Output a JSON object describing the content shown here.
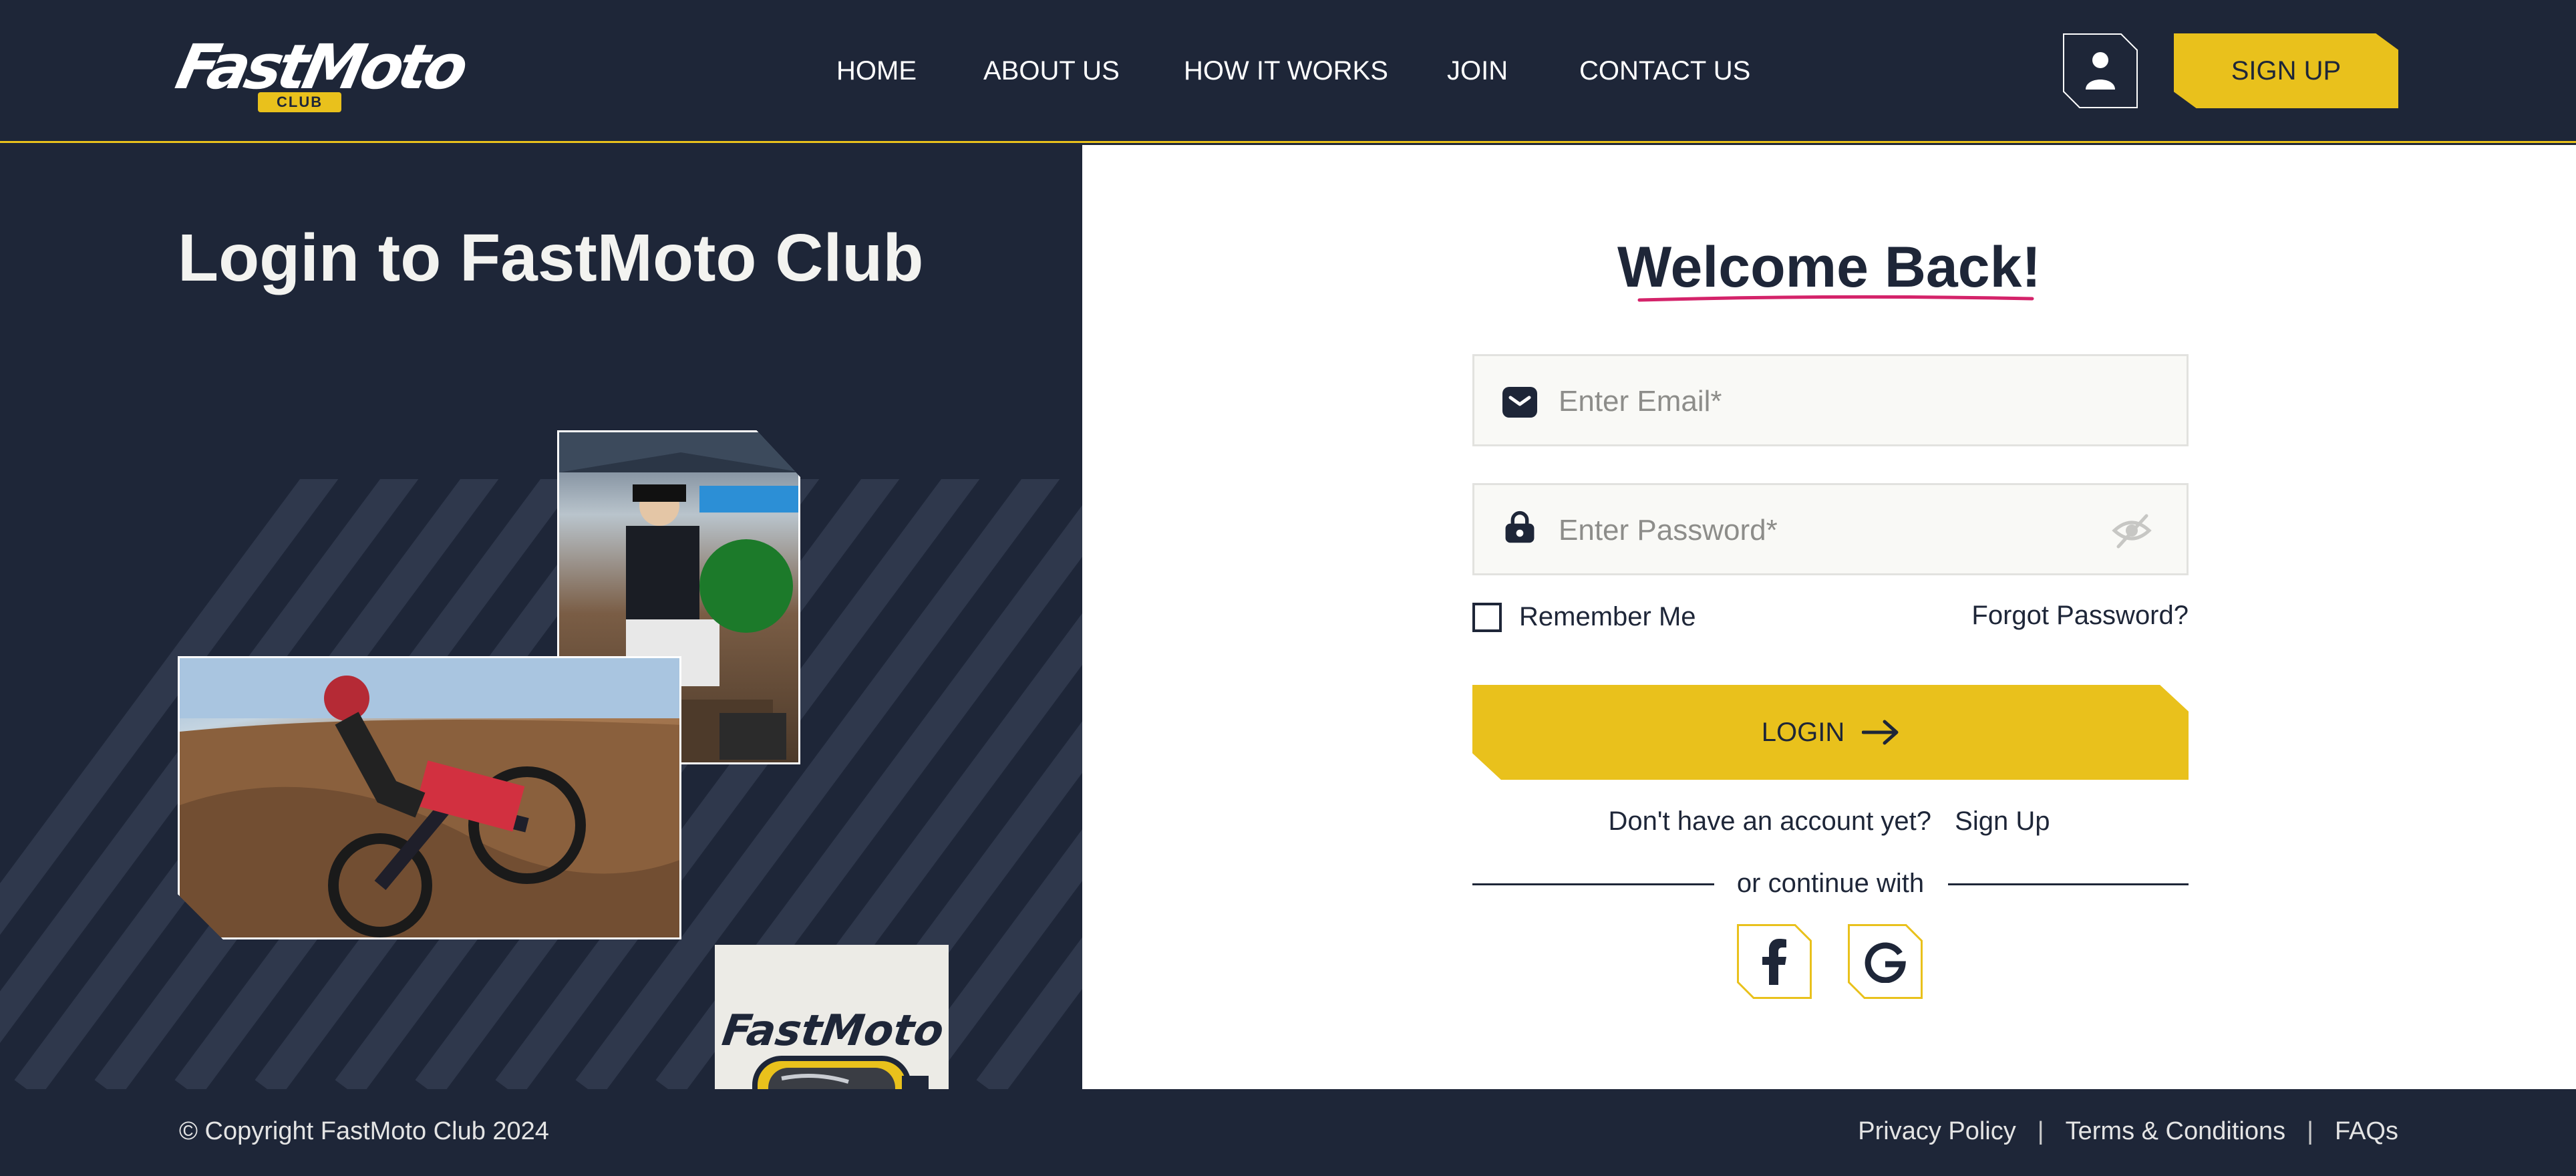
{
  "brand": {
    "logo_text": "FastMoto",
    "logo_sub": "CLUB",
    "accent": "#e9c11c",
    "dark": "#1e2638"
  },
  "nav": {
    "items": [
      "HOME",
      "ABOUT US",
      "HOW IT WORKS",
      "JOIN",
      "CONTACT US"
    ]
  },
  "header": {
    "user_icon": "user-icon",
    "signup_label": "SIGN UP"
  },
  "left": {
    "title": "Login to FastMoto Club",
    "logo_tile_text": "FastMoto",
    "logo_tile_icon": "goggles-icon"
  },
  "form": {
    "heading": "Welcome Back!",
    "email_placeholder": "Enter Email*",
    "email_icon": "mail-icon",
    "password_placeholder": "Enter Password*",
    "password_icon": "lock-icon",
    "toggle_icon": "eye-slash-icon",
    "remember_label": "Remember Me",
    "forgot_label": "Forgot Password?",
    "login_label": "LOGIN",
    "login_icon": "arrow-right-icon",
    "no_account_text": "Don't have an account yet?",
    "signup_link": "Sign Up",
    "divider_text": "or continue with",
    "social": [
      {
        "label": "f",
        "icon": "facebook-icon"
      },
      {
        "label": "G",
        "icon": "google-icon"
      }
    ]
  },
  "footer": {
    "copyright": "© Copyright FastMoto Club 2024",
    "links": [
      "Privacy Policy",
      "Terms & Conditions",
      "FAQs"
    ]
  }
}
